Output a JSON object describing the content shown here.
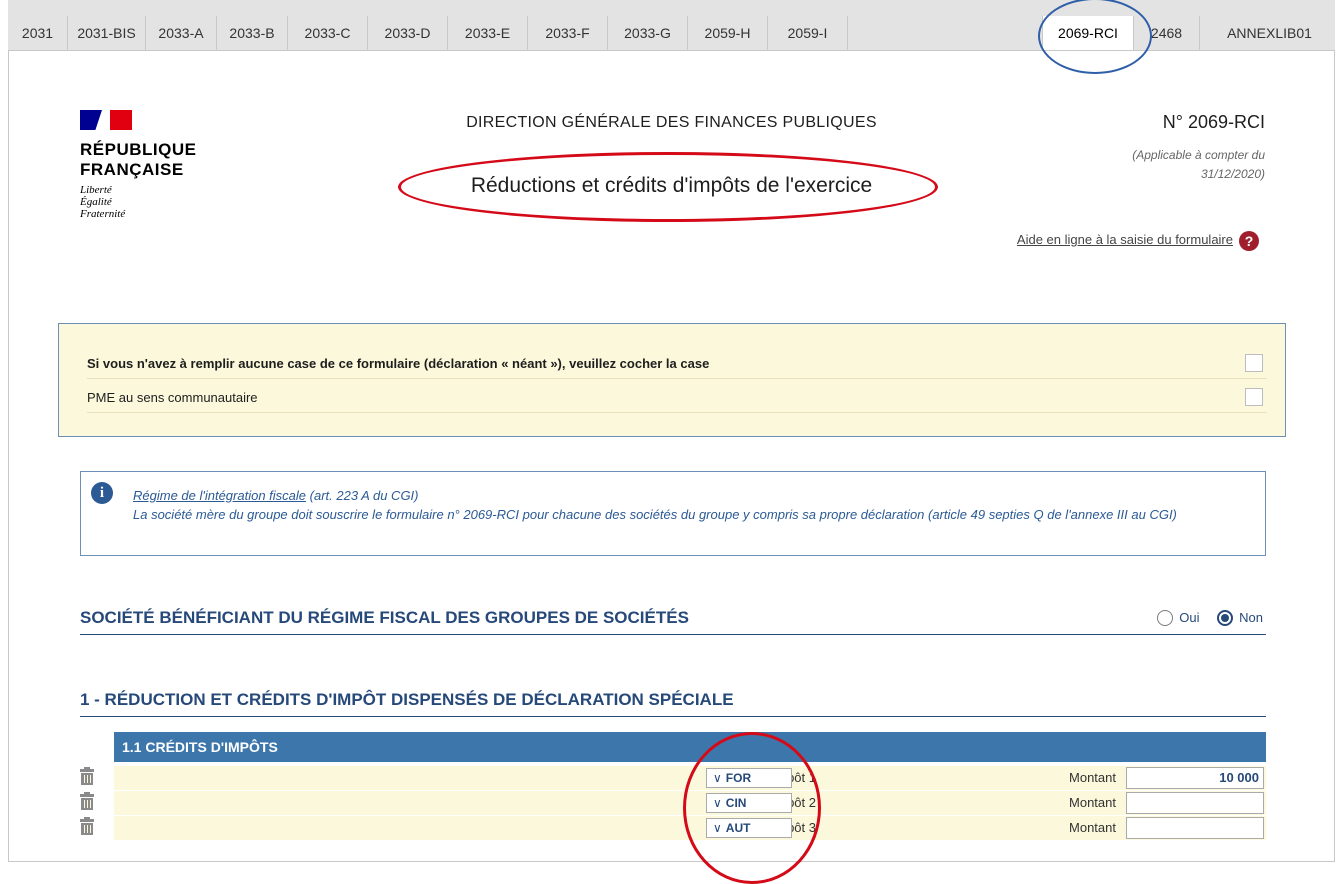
{
  "tabs": [
    {
      "label": "2031",
      "active": false
    },
    {
      "label": "2031-BIS",
      "active": false
    },
    {
      "label": "2033-A",
      "active": false
    },
    {
      "label": "2033-B",
      "active": false
    },
    {
      "label": "2033-C",
      "active": false
    },
    {
      "label": "2033-D",
      "active": false
    },
    {
      "label": "2033-E",
      "active": false
    },
    {
      "label": "2033-F",
      "active": false
    },
    {
      "label": "2033-G",
      "active": false
    },
    {
      "label": "2059-H",
      "active": false
    },
    {
      "label": "2059-I",
      "active": false
    },
    {
      "label": "2069-RCI",
      "active": true
    },
    {
      "label": "2468",
      "active": false
    },
    {
      "label": "ANNEXLIB01",
      "active": false
    }
  ],
  "header": {
    "republique": "RÉPUBLIQUE",
    "francaise": "FRANÇAISE",
    "devise": [
      "Liberté",
      "Égalité",
      "Fraternité"
    ],
    "direction": "DIRECTION GÉNÉRALE DES FINANCES PUBLIQUES",
    "form_title": "Réductions et crédits d'impôts de l'exercice",
    "form_number": "N° 2069-RCI",
    "applicable_line1": "(Applicable à compter du",
    "applicable_line2": "31/12/2020)",
    "help_link": "Aide en ligne à la saisie du formulaire",
    "help_icon": "?"
  },
  "options": {
    "neant_label": "Si vous n'avez à remplir aucune case de ce formulaire (déclaration « néant »), veuillez cocher la case",
    "neant_checked": false,
    "pme_label": "PME au sens communautaire",
    "pme_checked": false
  },
  "info": {
    "link": "Régime de l'intégration fiscale",
    "ref": " (art. 223 A du CGI)",
    "text": "La société mère du groupe doit souscrire le formulaire n° 2069-RCI pour chacune des sociétés du groupe y compris sa propre déclaration (article 49 septies Q de l'annexe III au CGI)"
  },
  "groupe": {
    "title": "SOCIÉTÉ BÉNÉFICIANT DU RÉGIME FISCAL DES GROUPES DE SOCIÉTÉS",
    "oui": "Oui",
    "non": "Non",
    "selected": "Non"
  },
  "section1": {
    "title": "1 - RÉDUCTION ET CRÉDITS D'IMPÔT DISPENSÉS DE DÉCLARATION SPÉCIALE",
    "subtitle": "1.1 CRÉDITS D'IMPÔTS",
    "montant_label": "Montant",
    "credits": [
      {
        "label": "Crédit d'impôt 1",
        "code": "FOR",
        "montant": "10 000"
      },
      {
        "label": "Crédit d'impôt 2",
        "code": "CIN",
        "montant": ""
      },
      {
        "label": "Crédit d'impôt 3",
        "code": "AUT",
        "montant": ""
      }
    ]
  },
  "colors": {
    "tab_bg": "#e3e3e3",
    "panel_yellow": "#fbf8db",
    "section_blue": "#26497a",
    "table_header_blue": "#3d76ab",
    "annotation_red": "#d40a18",
    "annotation_blue": "#2f5fa8"
  }
}
